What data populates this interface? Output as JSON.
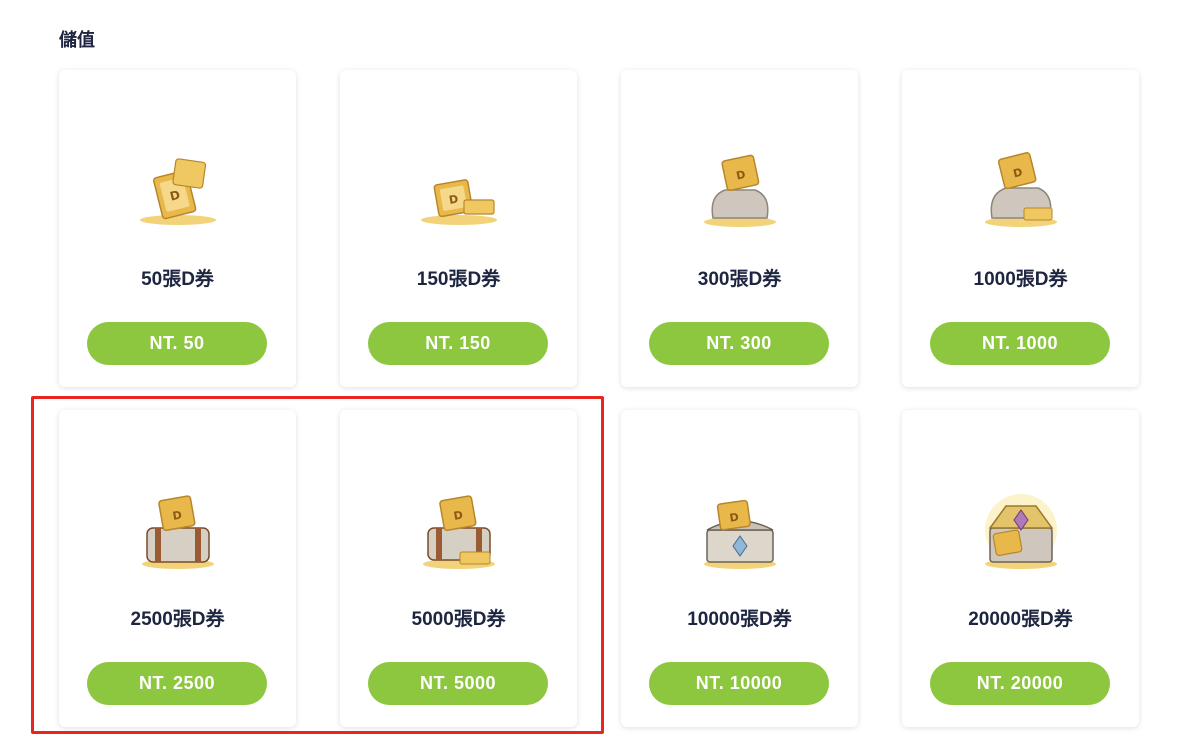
{
  "page": {
    "title": "儲值"
  },
  "products": [
    {
      "label": "50張D券",
      "price": "NT. 50",
      "icon": "ticket-bundle-icon"
    },
    {
      "label": "150張D券",
      "price": "NT. 150",
      "icon": "ticket-bundle-icon"
    },
    {
      "label": "300張D券",
      "price": "NT. 300",
      "icon": "ticket-bag-icon"
    },
    {
      "label": "1000張D券",
      "price": "NT. 1000",
      "icon": "ticket-bag-icon"
    },
    {
      "label": "2500張D券",
      "price": "NT. 2500",
      "icon": "ticket-satchel-icon"
    },
    {
      "label": "5000張D券",
      "price": "NT. 5000",
      "icon": "ticket-satchel-icon"
    },
    {
      "label": "10000張D券",
      "price": "NT. 10000",
      "icon": "treasure-chest-icon"
    },
    {
      "label": "20000張D券",
      "price": "NT. 20000",
      "icon": "treasure-chest-icon"
    }
  ],
  "colors": {
    "button_bg": "#8dc63f",
    "text_dark": "#1d2540",
    "highlight_border": "#e8261f",
    "gold": "#e8b94a"
  }
}
